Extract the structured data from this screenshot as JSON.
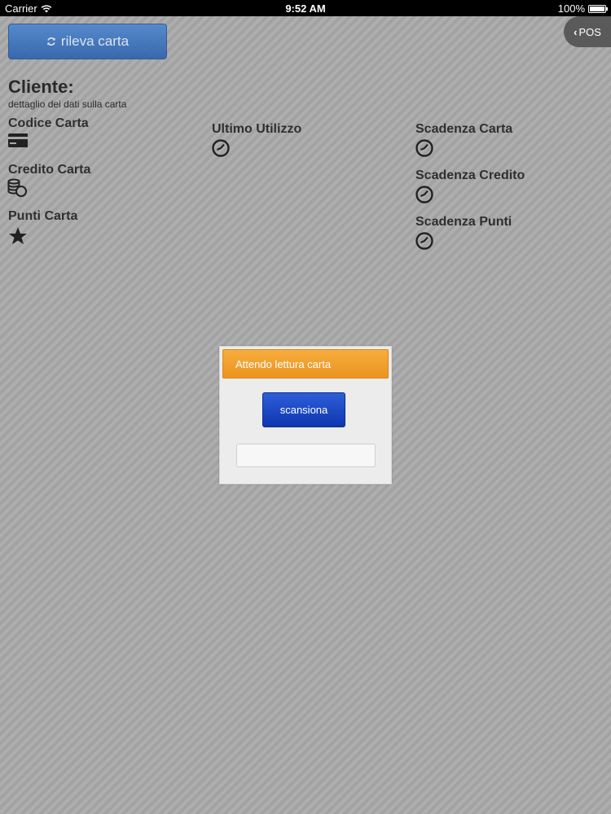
{
  "status_bar": {
    "carrier": "Carrier",
    "time": "9:52 AM",
    "battery": "100%"
  },
  "toolbar": {
    "rileva_label": "rileva carta",
    "pos_label": "POS"
  },
  "cliente": {
    "title": "Cliente:",
    "subtitle": "dettaglio dei dati sulla carta"
  },
  "fields": {
    "codice_carta": {
      "label": "Codice Carta",
      "icon": "credit-card-icon"
    },
    "credito_carta": {
      "label": "Credito Carta",
      "icon": "coins-icon"
    },
    "punti_carta": {
      "label": "Punti Carta",
      "icon": "star-icon"
    },
    "ultimo_utilizzo": {
      "label": "Ultimo Utilizzo",
      "icon": "clock-icon"
    },
    "scadenza_carta": {
      "label": "Scadenza Carta",
      "icon": "clock-icon"
    },
    "scadenza_credito": {
      "label": "Scadenza Credito",
      "icon": "clock-icon"
    },
    "scadenza_punti": {
      "label": "Scadenza Punti",
      "icon": "clock-icon"
    }
  },
  "modal": {
    "title": "Attendo lettura carta",
    "scan_label": "scansiona",
    "input_value": ""
  },
  "colors": {
    "background": "#a9a9a9",
    "primary_button": "#2f64ad",
    "modal_header": "#eb9420",
    "scan_button": "#0f35b0"
  }
}
